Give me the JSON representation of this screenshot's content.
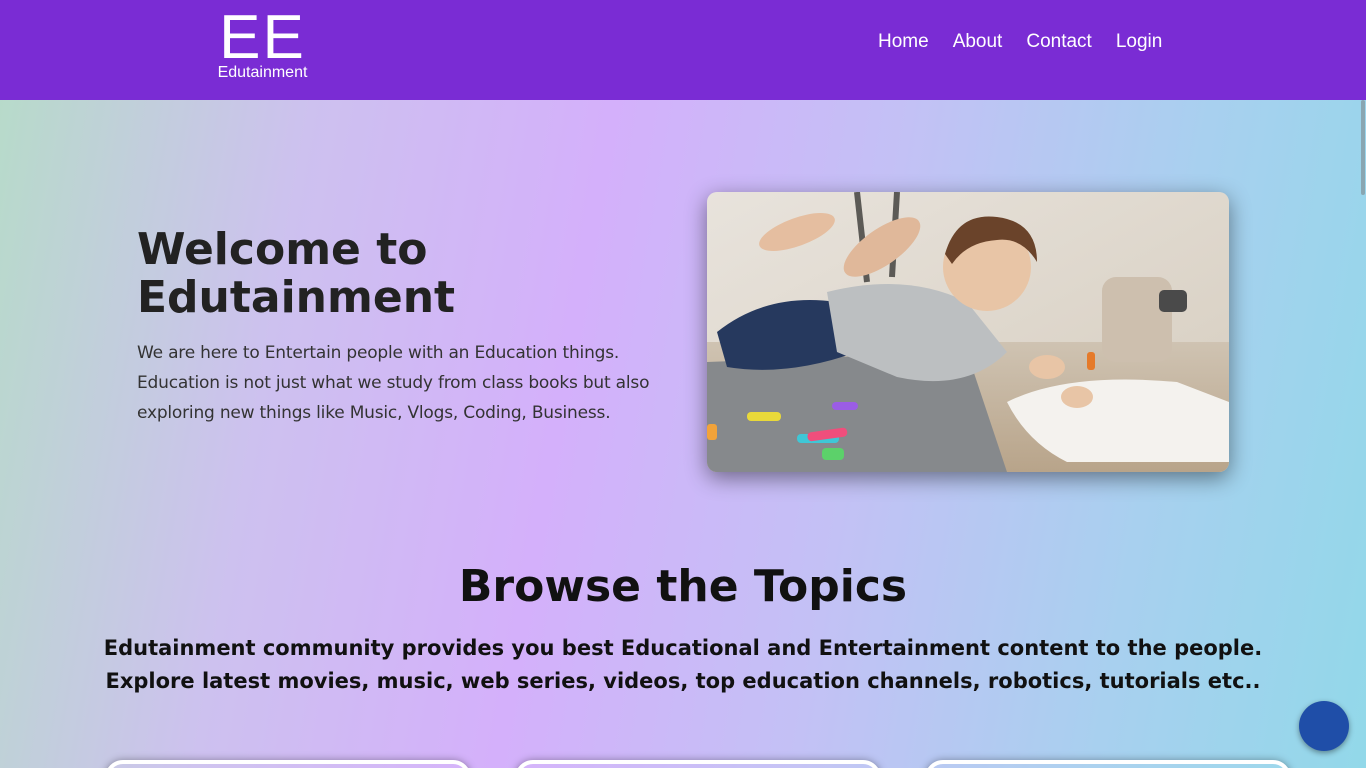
{
  "navbar": {
    "logo_mark": "EE",
    "logo_text": "Edutainment",
    "links": [
      "Home",
      "About",
      "Contact",
      "Login"
    ],
    "background": "#7a2cd4"
  },
  "hero": {
    "title": "Welcome to Edutainment",
    "description": "We are here to Entertain people with an Education things. Education is not just what we study from class books but also exploring new things like Music, Vlogs, Coding, Business.",
    "image_icon": "child-drawing-photo"
  },
  "browse": {
    "title": "Browse the Topics",
    "line1": "Edutainment community provides you best Educational and Entertainment content to the people.",
    "line2": "Explore latest movies, music, web series, videos, top education channels, robotics, tutorials etc.."
  },
  "floating": {
    "chat_icon": "chat-bubble-icon",
    "color": "#1f4ea8"
  }
}
